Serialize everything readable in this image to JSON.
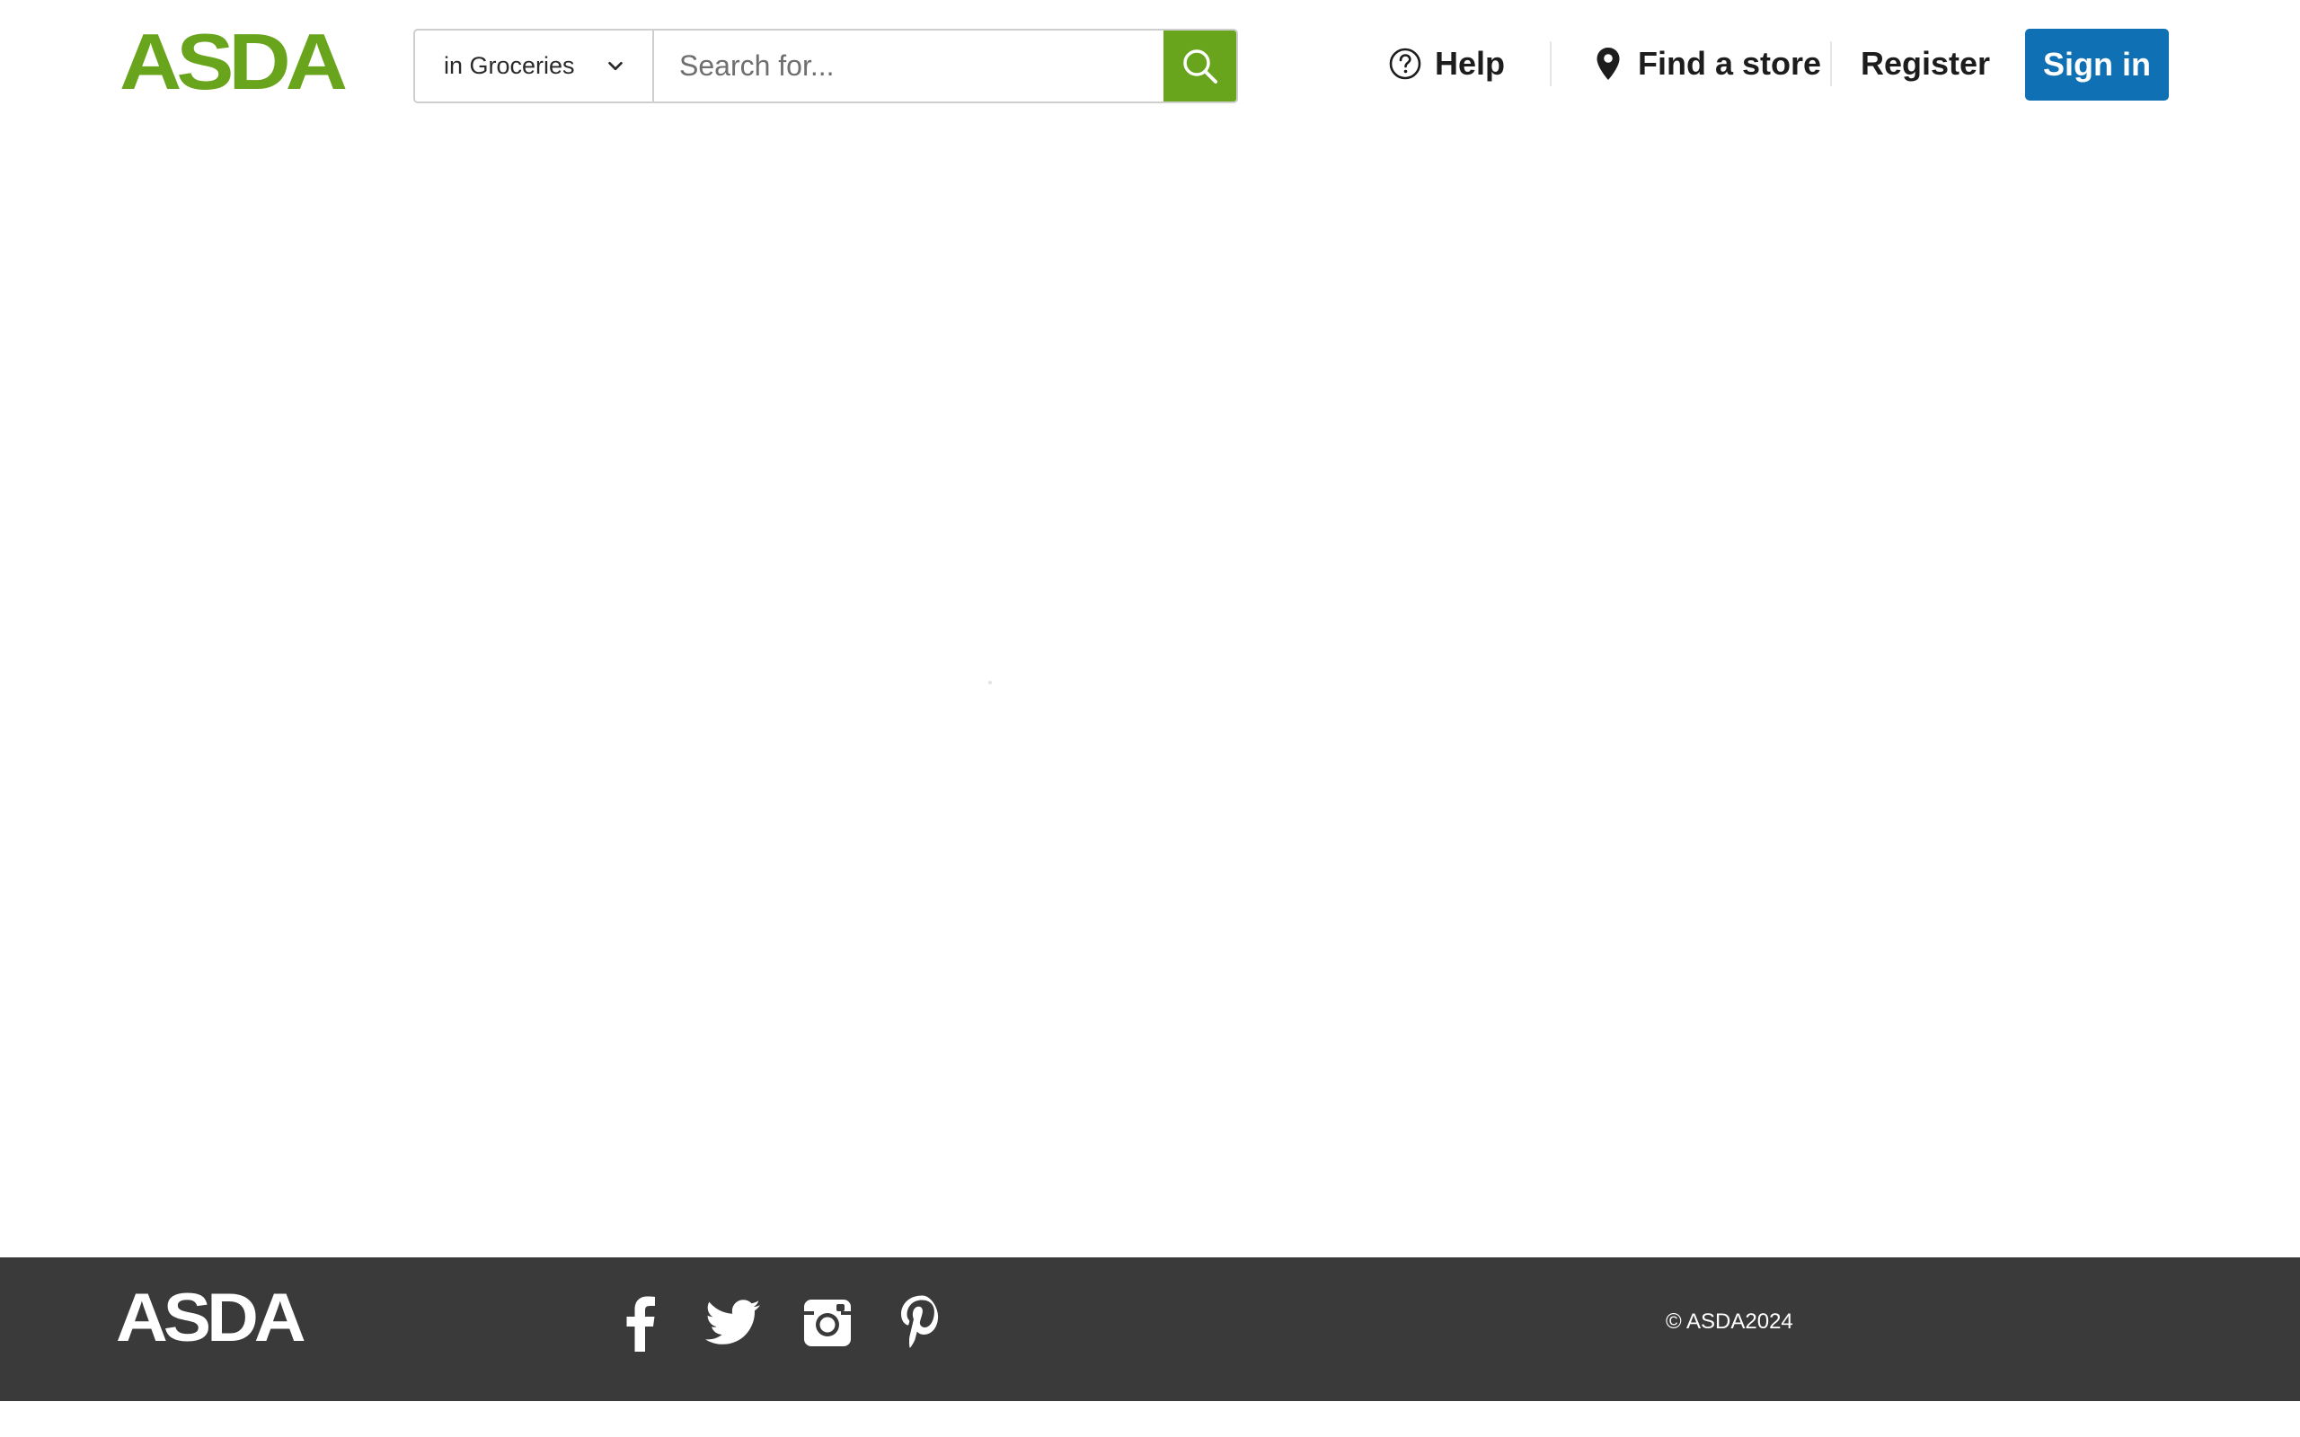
{
  "header": {
    "logo_text": "ASDA",
    "search": {
      "department_label": "in Groceries",
      "placeholder": "Search for..."
    },
    "nav": {
      "help_label": "Help",
      "find_store_label": "Find a store",
      "register_label": "Register",
      "sign_in_label": "Sign in"
    }
  },
  "footer": {
    "logo_text": "ASDA",
    "social": [
      "facebook-icon",
      "twitter-icon",
      "instagram-icon",
      "pinterest-icon"
    ],
    "copyright": "© ASDA2024"
  },
  "colors": {
    "brand_green": "#68a51c",
    "sign_in_blue": "#0f71b3",
    "footer_bg": "#3a3a3a"
  }
}
